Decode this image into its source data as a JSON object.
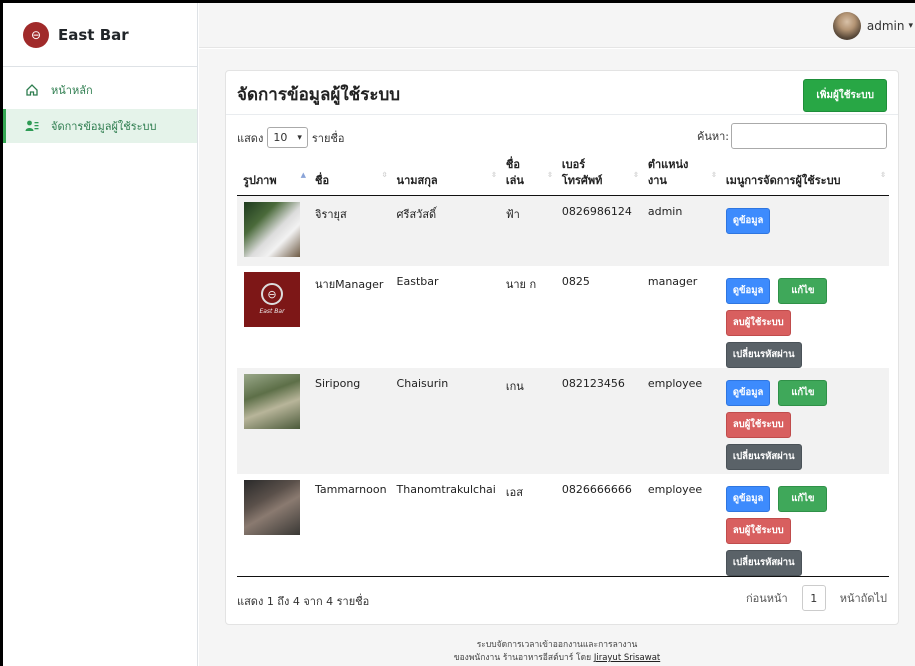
{
  "sidebar": {
    "brand": "East Bar",
    "items": [
      {
        "label": "หน้าหลัก",
        "icon": "home-icon",
        "active": false
      },
      {
        "label": "จัดการข้อมูลผู้ใช้ระบบ",
        "icon": "user-list-icon",
        "active": true
      }
    ]
  },
  "topbar": {
    "username": "admin",
    "caret": "▾"
  },
  "card": {
    "title": "จัดการข้อมูลผู้ใช้ระบบ",
    "add_button": "เพิ่มผู้ใช้ระบบ"
  },
  "controls": {
    "show_prefix": "แสดง",
    "page_length": "10",
    "show_suffix": "รายชื่อ",
    "search_label": "ค้นหา:",
    "search_value": ""
  },
  "table": {
    "headers": [
      "รูปภาพ",
      "ชื่อ",
      "นามสกุล",
      "ชื่อเล่น",
      "เบอร์โทรศัพท์",
      "ตำแหน่งงาน",
      "เมนูการจัดการผู้ใช้ระบบ"
    ],
    "header_lines": {
      "nickname": [
        "ชื่อ",
        "เล่น"
      ],
      "phone": [
        "เบอร์",
        "โทรศัพท์"
      ],
      "position": [
        "ตำแหน่ง",
        "งาน"
      ]
    },
    "rows": [
      {
        "first": "จิรายุส",
        "last": "ศรีสวัสดิ์",
        "nick": "ฟ้า",
        "phone": "0826986124",
        "position": "admin"
      },
      {
        "first": "นายManager",
        "last": "Eastbar",
        "nick": "นาย ก",
        "phone": "0825",
        "position": "manager"
      },
      {
        "first": "Siripong",
        "last": "Chaisurin",
        "nick": "เกน",
        "phone": "082123456",
        "position": "employee"
      },
      {
        "first": "Tammarnoon",
        "last": "Thanomtrakulchai",
        "nick": "เอส",
        "phone": "0826666666",
        "position": "employee"
      }
    ],
    "actions": {
      "view": "ดูข้อมูล",
      "edit": "แก้ไข",
      "delete": "ลบผู้ใช้ระบบ",
      "change_password": "เปลี่ยนรหัสผ่าน"
    },
    "logo_caption": "East Bar"
  },
  "pagination": {
    "info": "แสดง 1 ถึง 4 จาก 4 รายชื่อ",
    "prev": "ก่อนหน้า",
    "current": "1",
    "next": "หน้าถัดไป"
  },
  "footer": {
    "line1": "ระบบจัดการเวลาเข้าออกงานและการลางาน",
    "line2_prefix": "ของพนักงาน ร้านอาหารอีสต์บาร์ โดย",
    "author": "Jirayut Srisawat"
  },
  "colors": {
    "accent_green": "#28a745",
    "view_blue": "#3d8bfd",
    "delete_red": "#d85f5f",
    "password_gray": "#5a6268"
  }
}
